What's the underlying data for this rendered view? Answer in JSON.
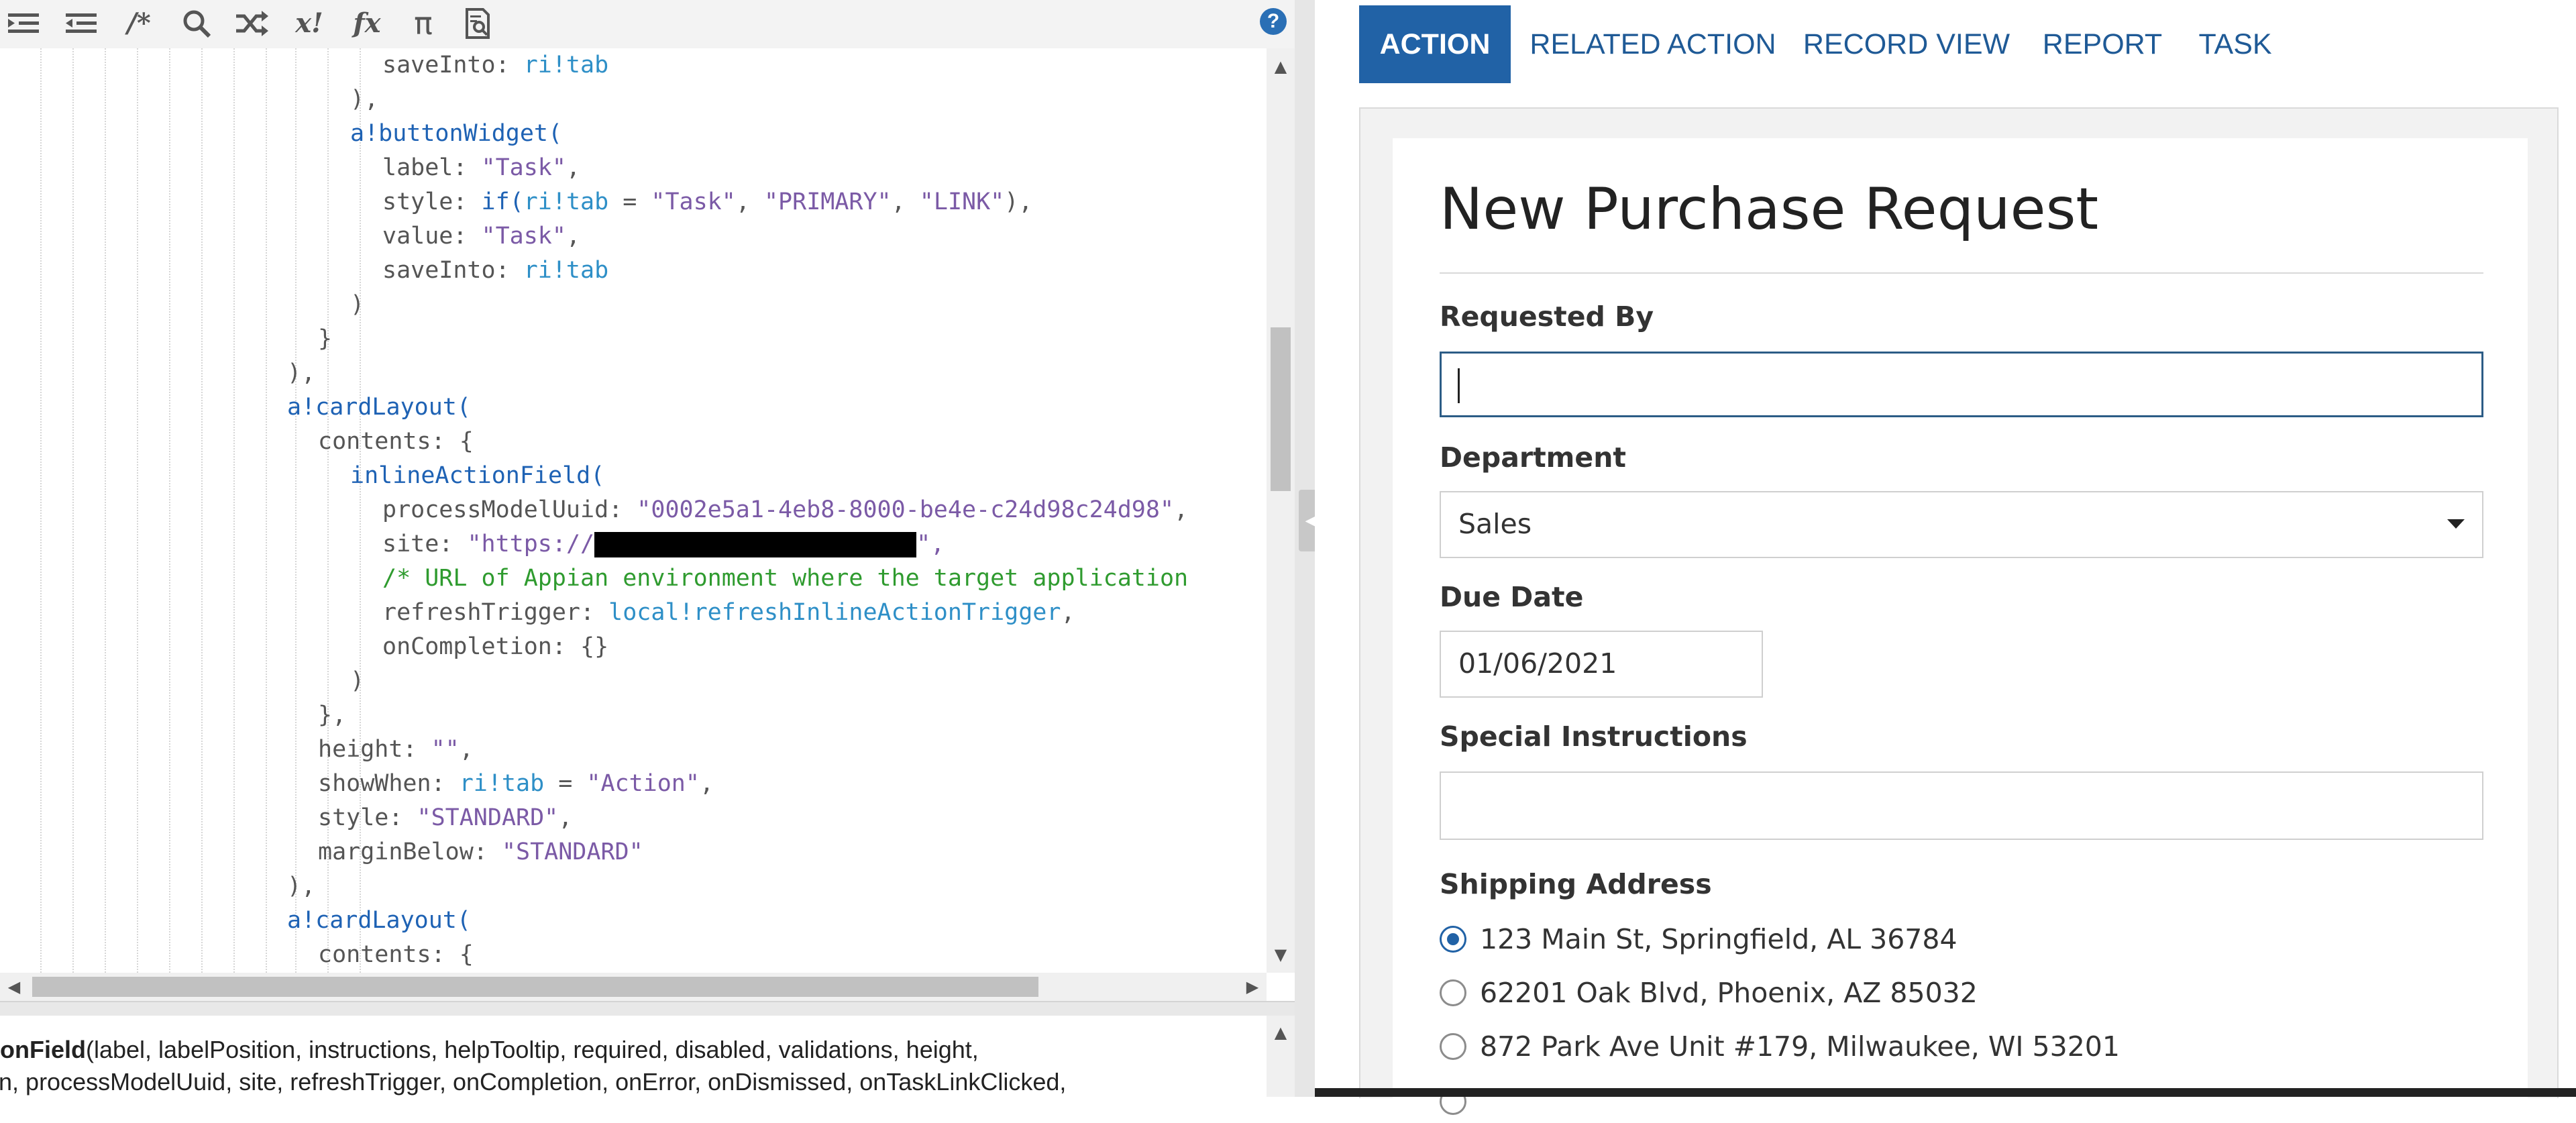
{
  "editor": {
    "toolbar": {
      "icons": [
        "indent-decrease-icon",
        "indent-increase-icon",
        "comment-icon",
        "search-icon",
        "shuffle-icon",
        "no-exclamation-icon",
        "function-icon",
        "pi-icon",
        "document-search-icon",
        "help-icon"
      ],
      "comment_glyph": "/*",
      "x_glyph": "x!",
      "fx_glyph": "fx",
      "pi_glyph": "π",
      "help_glyph": "?"
    },
    "code_lines": [
      "saveInto: ri!tab",
      "),",
      "a!buttonWidget(",
      "label: \"Task\",",
      "style: if(ri!tab = \"Task\", \"PRIMARY\", \"LINK\"),",
      "value: \"Task\",",
      "saveInto: ri!tab",
      ")",
      "}",
      "),",
      "a!cardLayout(",
      "contents: {",
      "inlineActionField(",
      "processModelUuid: \"0002e5a1-4eb8-8000-be4e-c24d98c24d98\",",
      "site: \"https://[redacted]\",",
      "/* URL of Appian environment where the target application",
      "refreshTrigger: local!refreshInlineActionTrigger,",
      "onCompletion: {}",
      ")",
      "},",
      "height: \"\",",
      "showWhen: ri!tab = \"Action\",",
      "style: \"STANDARD\",",
      "marginBelow: \"STANDARD\"",
      "),",
      "a!cardLayout(",
      "contents: {"
    ],
    "tokens": {
      "saveInto": "saveInto: ",
      "ri_tab": "ri!tab",
      "close_paren_comma": "),",
      "button_widget": "a!buttonWidget(",
      "label_key": "label: ",
      "task_str": "\"Task\"",
      "comma": ",",
      "style_key": "style: ",
      "if_fn": "if(",
      "eq": " = ",
      "primary_str": "\"PRIMARY\"",
      "link_str": "\"LINK\"",
      "close_paren": ")",
      "value_key": "value: ",
      "close_brace": "}",
      "card_layout": "a!cardLayout(",
      "contents": "contents: {",
      "inline_action": "inlineActionField(",
      "uuid_key": "processModelUuid: ",
      "uuid_val": "\"0002e5a1-4eb8-8000-be4e-c24d98c24d98\"",
      "site_key": "site: ",
      "site_open": "\"https://",
      "site_close": "\",",
      "comment": "/* URL of Appian environment where the target application",
      "refresh_key": "refreshTrigger: ",
      "refresh_val": "local!refreshInlineActionTrigger",
      "oncompletion": "onCompletion: {}",
      "close_brace_comma": "},",
      "height_key": "height: ",
      "empty_str": "\"\"",
      "showwhen_key": "showWhen: ",
      "action_str": "\"Action\"",
      "standard_str": "\"STANDARD\"",
      "marginbelow_key": "marginBelow: "
    },
    "hint": {
      "line1_bold": "tionField",
      "line1_rest": "(label, labelPosition, instructions, helpTooltip, required, disabled, validations, height,",
      "line2": "en, processModelUuid, site, refreshTrigger, onCompletion, onError, onDismissed, onTaskLinkClicked,"
    }
  },
  "preview": {
    "tabs": [
      "ACTION",
      "RELATED ACTION",
      "RECORD VIEW",
      "REPORT",
      "TASK"
    ],
    "active_tab": "ACTION",
    "form": {
      "title": "New Purchase Request",
      "requested_by_label": "Requested By",
      "requested_by_value": "",
      "department_label": "Department",
      "department_value": "Sales",
      "due_date_label": "Due Date",
      "due_date_value": "01/06/2021",
      "special_instructions_label": "Special Instructions",
      "special_instructions_value": "",
      "shipping_address_label": "Shipping Address",
      "addresses": [
        {
          "label": "123 Main St, Springfield, AL 36784",
          "selected": true
        },
        {
          "label": "62201 Oak Blvd, Phoenix, AZ 85032",
          "selected": false
        },
        {
          "label": "872 Park Ave Unit #179, Milwaukee, WI 53201",
          "selected": false
        }
      ]
    }
  },
  "colors": {
    "accent": "#2162a6",
    "code_function": "#1e62b4",
    "code_string": "#7b5aa6",
    "code_variable": "#2e8fc7",
    "code_comment": "#2f9b2f"
  }
}
